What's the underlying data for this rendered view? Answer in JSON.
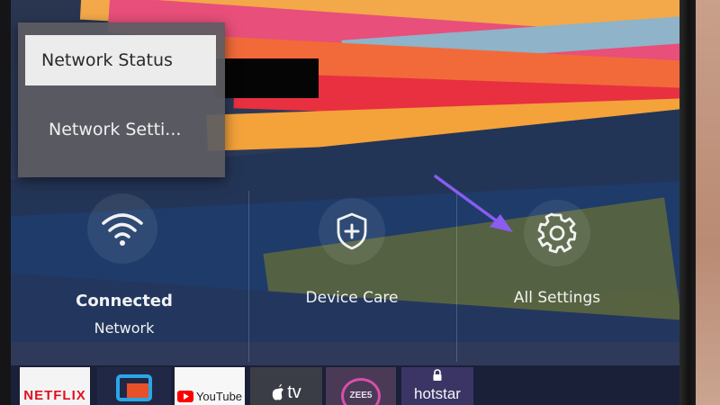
{
  "menu": {
    "items": [
      {
        "label": "Network Status"
      },
      {
        "label": "Network Setti..."
      }
    ]
  },
  "tiles": [
    {
      "title": "Connected",
      "subtitle": "Network",
      "icon": "wifi-icon"
    },
    {
      "title": "Device Care",
      "icon": "shield-plus-icon"
    },
    {
      "title": "All Settings",
      "icon": "gear-icon"
    }
  ],
  "apps": [
    {
      "label": "NETFLIX",
      "icon": "netflix-icon"
    },
    {
      "label": "",
      "icon": "cast-icon"
    },
    {
      "label": "YouTube",
      "icon": "youtube-icon"
    },
    {
      "label": "tv",
      "icon": "apple-tv-icon"
    },
    {
      "label": "ZEE5",
      "icon": "zee5-icon"
    },
    {
      "label": "hotstar",
      "icon": "hotstar-icon"
    }
  ],
  "colors": {
    "arrow": "#8a5cf0",
    "netflix_red": "#e01020"
  }
}
